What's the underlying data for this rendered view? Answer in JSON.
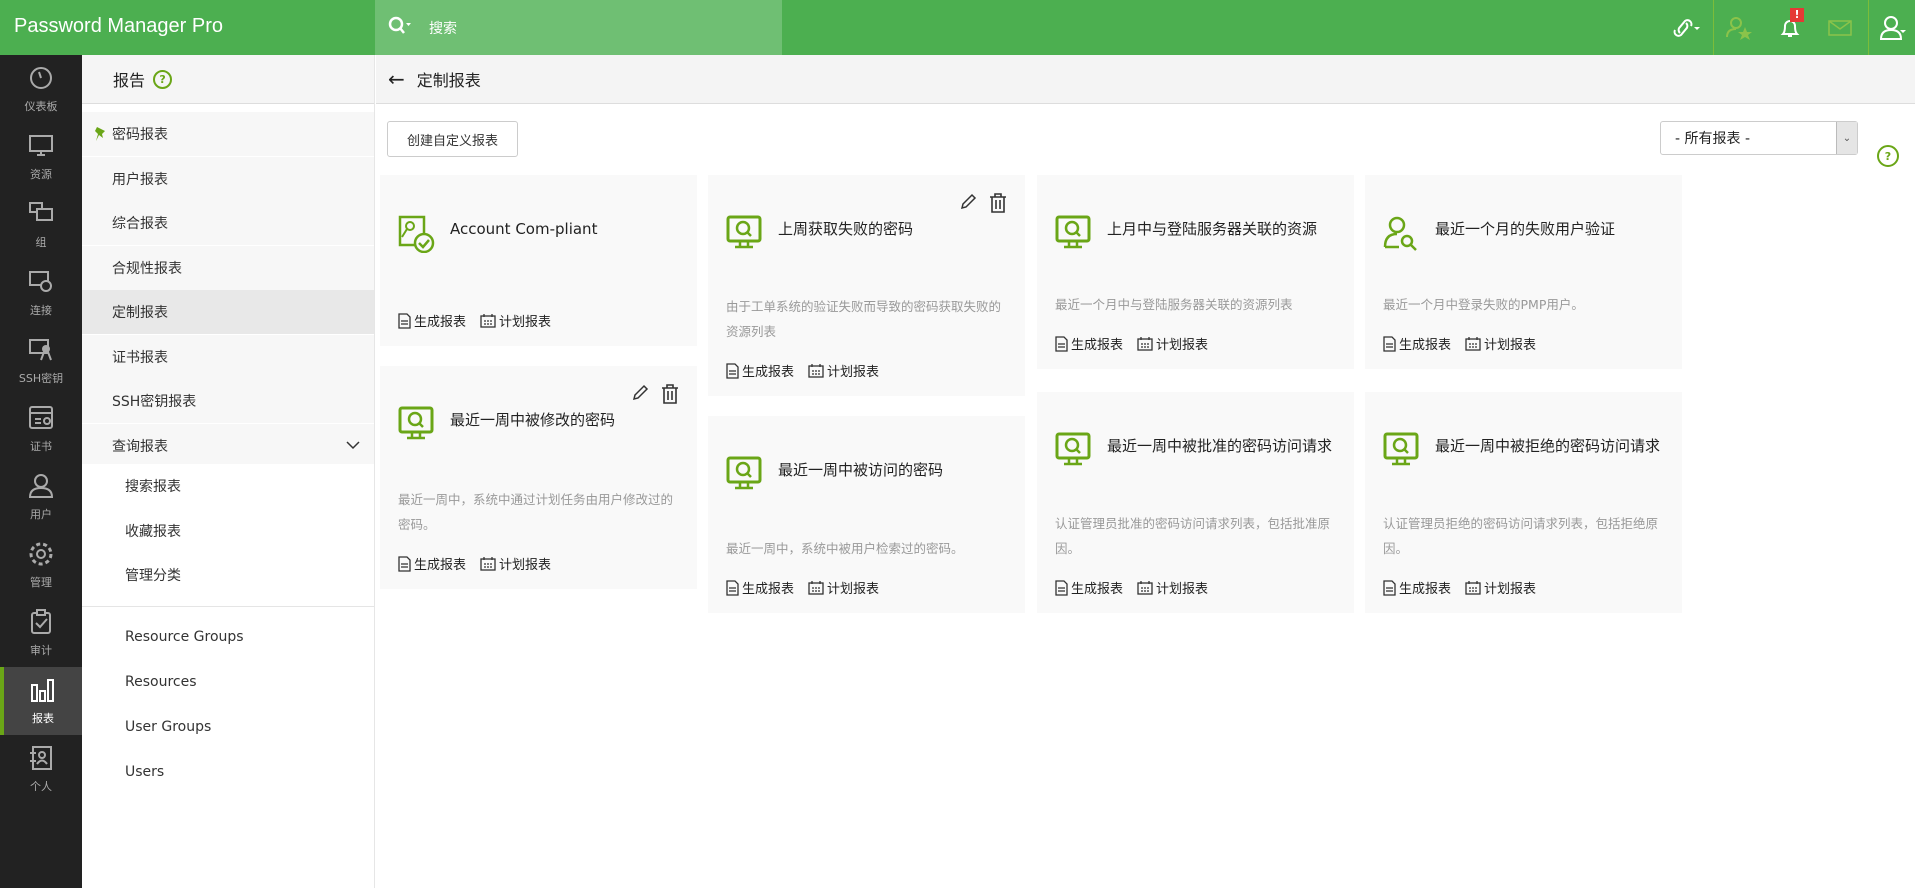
{
  "app": {
    "logo": "Password Manager Pro",
    "search_placeholder": "搜索",
    "alert_badge": "!"
  },
  "colors": {
    "header": "#4caf50",
    "accent": "#6aa617",
    "rail": "#222222"
  },
  "rail": [
    {
      "label": "仪表板",
      "icon": "dashboard-icon"
    },
    {
      "label": "资源",
      "icon": "monitor-icon"
    },
    {
      "label": "组",
      "icon": "group-icon"
    },
    {
      "label": "连接",
      "icon": "connection-icon"
    },
    {
      "label": "SSH密钥",
      "icon": "ssh-key-icon"
    },
    {
      "label": "证书",
      "icon": "certificate-icon"
    },
    {
      "label": "用户",
      "icon": "user-icon"
    },
    {
      "label": "管理",
      "icon": "gear-icon"
    },
    {
      "label": "审计",
      "icon": "clipboard-check-icon"
    },
    {
      "label": "报表",
      "icon": "bar-chart-icon",
      "active": true
    },
    {
      "label": "个人",
      "icon": "contact-book-icon"
    }
  ],
  "sidebar": {
    "title": "报告",
    "help": "?",
    "items": [
      {
        "label": "密码报表",
        "pinned": true
      },
      {
        "label": "用户报表"
      },
      {
        "label": "综合报表"
      },
      {
        "label": "合规性报表"
      },
      {
        "label": "定制报表",
        "selected": true
      },
      {
        "label": "证书报表"
      },
      {
        "label": "SSH密钥报表"
      },
      {
        "label": "查询报表",
        "expand": true
      }
    ],
    "subitems": [
      "搜索报表",
      "收藏报表",
      "管理分类"
    ],
    "groups": [
      "Resource Groups",
      "Resources",
      "User Groups",
      "Users"
    ]
  },
  "page": {
    "title": "定制报表",
    "create_button": "创建自定义报表",
    "filter": "- 所有报表 -",
    "help": "?"
  },
  "cards": [
    {
      "title": "Account Com-pliant",
      "desc": "",
      "icon": "account-compliant-icon",
      "editable": false
    },
    {
      "title": "最近一周中被修改的密码",
      "desc": "最近一周中，系统中通过计划任务由用户修改过的密码。",
      "icon": "monitor-search-icon",
      "editable": true
    },
    {
      "title": "上周获取失败的密码",
      "desc": "由于工单系统的验证失败而导致的密码获取失败的资源列表",
      "icon": "monitor-search-icon",
      "editable": true
    },
    {
      "title": "最近一周中被访问的密码",
      "desc": "最近一周中，系统中被用户检索过的密码。",
      "icon": "monitor-search-icon",
      "editable": false
    },
    {
      "title": "上月中与登陆服务器关联的资源",
      "desc": "最近一个月中与登陆服务器关联的资源列表",
      "icon": "monitor-search-icon",
      "editable": false
    },
    {
      "title": "最近一周中被批准的密码访问请求",
      "desc": "认证管理员批准的密码访问请求列表，包括批准原因。",
      "icon": "monitor-search-icon",
      "editable": false
    },
    {
      "title": "最近一个月的失败用户验证",
      "desc": "最近一个月中登录失败的PMP用户。",
      "icon": "user-search-icon",
      "editable": false
    },
    {
      "title": "最近一周中被拒绝的密码访问请求",
      "desc": "认证管理员拒绝的密码访问请求列表，包括拒绝原因。",
      "icon": "monitor-search-icon",
      "editable": false
    }
  ],
  "card_links": {
    "generate": "生成报表",
    "schedule": "计划报表"
  }
}
